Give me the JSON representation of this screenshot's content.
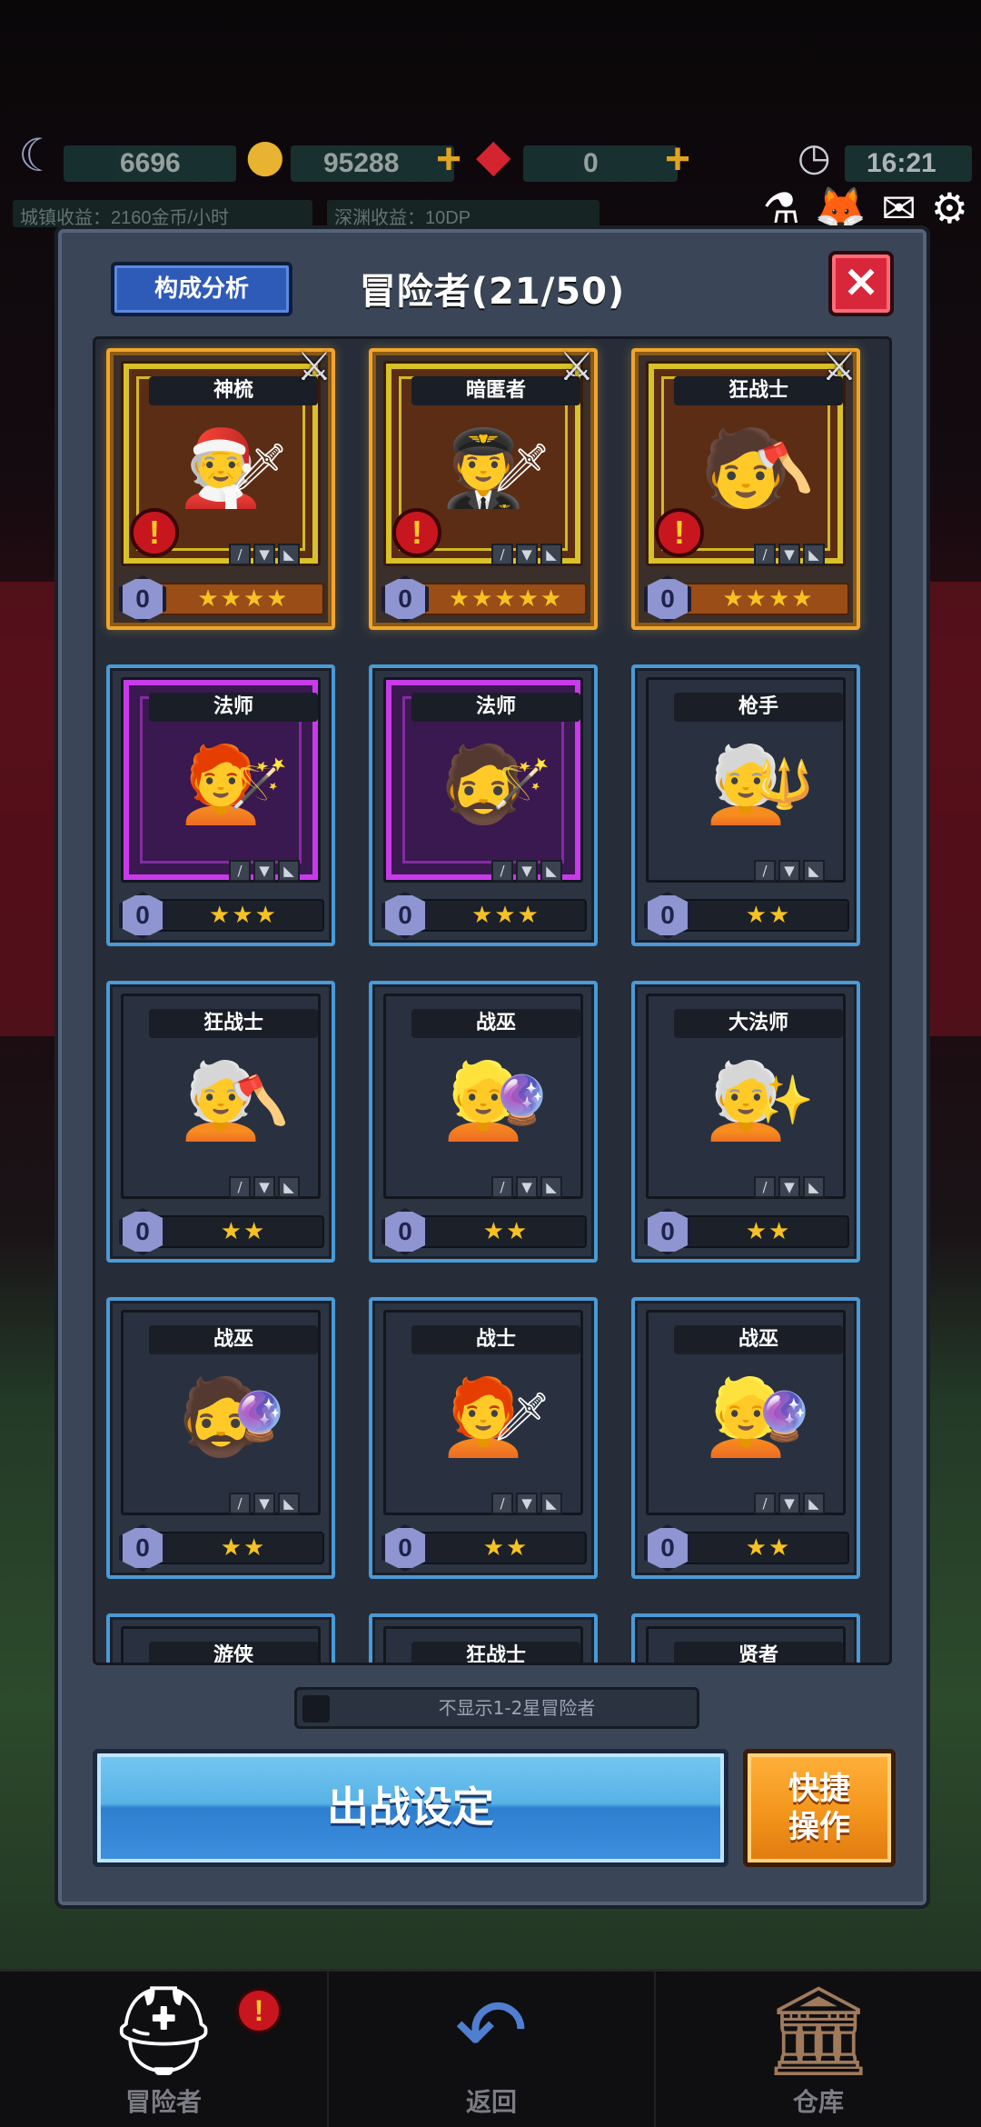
{
  "hud": {
    "moon_value": "6696",
    "gold_value": "95288",
    "gem_value": "0",
    "time": "16:21",
    "town_income": "城镇收益：2160金币/小时",
    "abyss_income": "深渊收益：10DP"
  },
  "panel": {
    "analysis_label": "构成分析",
    "title": "冒险者(21/50)",
    "close_label": "✕"
  },
  "cards": [
    {
      "name": "神梳",
      "level": "0",
      "stars": "★★★★",
      "hero": "🧑‍🎄",
      "weapon": "🗡"
    },
    {
      "name": "暗匿者",
      "level": "0",
      "stars": "★★★★★",
      "hero": "🧑‍✈️",
      "weapon": "🗡"
    },
    {
      "name": "狂战士",
      "level": "0",
      "stars": "★★★★",
      "hero": "🧑",
      "weapon": "🪓"
    },
    {
      "name": "法师",
      "level": "0",
      "stars": "★★★",
      "hero": "🧑‍🦰",
      "weapon": "🪄"
    },
    {
      "name": "法师",
      "level": "0",
      "stars": "★★★",
      "hero": "🧔",
      "weapon": "🪄"
    },
    {
      "name": "枪手",
      "level": "0",
      "stars": "★★",
      "hero": "🧑‍🦳",
      "weapon": "🔱"
    },
    {
      "name": "狂战士",
      "level": "0",
      "stars": "★★",
      "hero": "🧑‍🦳",
      "weapon": "🪓"
    },
    {
      "name": "战巫",
      "level": "0",
      "stars": "★★",
      "hero": "👱",
      "weapon": "🔮"
    },
    {
      "name": "大法师",
      "level": "0",
      "stars": "★★",
      "hero": "🧑‍🦳",
      "weapon": "✨"
    },
    {
      "name": "战巫",
      "level": "0",
      "stars": "★★",
      "hero": "🧔",
      "weapon": "🔮"
    },
    {
      "name": "战士",
      "level": "0",
      "stars": "★★",
      "hero": "🧑‍🦰",
      "weapon": "🗡"
    },
    {
      "name": "战巫",
      "level": "0",
      "stars": "★★",
      "hero": "👱",
      "weapon": "🔮"
    },
    {
      "name": "游侠",
      "level": "",
      "stars": "",
      "hero": "",
      "weapon": ""
    },
    {
      "name": "狂战士",
      "level": "",
      "stars": "",
      "hero": "",
      "weapon": ""
    },
    {
      "name": "贤者",
      "level": "",
      "stars": "",
      "hero": "",
      "weapon": ""
    }
  ],
  "equip_icons": [
    "/",
    "▼",
    "◣"
  ],
  "toggle_label": "不显示1-2星冒险者",
  "battle_label": "出战设定",
  "quick_label_1": "快捷",
  "quick_label_2": "操作",
  "nav": {
    "adventurers": "冒险者",
    "back": "返回",
    "warehouse": "仓库"
  },
  "colors": {
    "gold_frame": "#f0a52c",
    "blue_frame": "#4a9ad6",
    "purple_frame": "#c83aea",
    "star": "#f6c223"
  }
}
